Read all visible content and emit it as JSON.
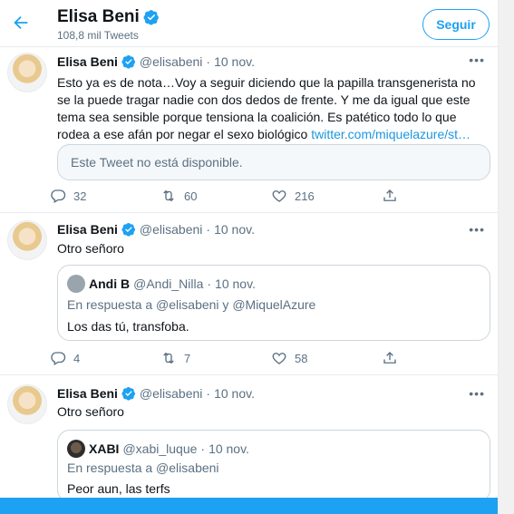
{
  "header": {
    "name": "Elisa Beni",
    "tweet_count": "108,8 mil Tweets",
    "follow_label": "Seguir"
  },
  "tweets": [
    {
      "name": "Elisa Beni",
      "handle": "@elisabeni",
      "dot": "·",
      "date": "10 nov.",
      "more": "•••",
      "text": "Esto ya es de nota…Voy a seguir diciendo que la papilla transgenerista no se la puede tragar nadie con dos dedos de frente. Y me da igual que este tema sea sensible porque tensiona la coalición. Es patético todo lo que rodea a ese afán por negar el sexo biológico ",
      "link": "twitter.com/miquelazure/st…",
      "quote_unavailable": "Este Tweet no está disponible.",
      "replies": "32",
      "retweets": "60",
      "likes": "216"
    },
    {
      "name": "Elisa Beni",
      "handle": "@elisabeni",
      "dot": "·",
      "date": "10 nov.",
      "more": "•••",
      "text": "Otro señoro",
      "quote": {
        "name": "Andi B",
        "handle": "@Andi_Nilla",
        "dot": "·",
        "date": "10 nov.",
        "reply_to": "En respuesta a @elisabeni y @MiquelAzure",
        "text": "Los das tú, transfoba."
      },
      "replies": "4",
      "retweets": "7",
      "likes": "58"
    },
    {
      "name": "Elisa Beni",
      "handle": "@elisabeni",
      "dot": "·",
      "date": "10 nov.",
      "more": "•••",
      "text": "Otro señoro",
      "quote": {
        "name": "XABI",
        "handle": "@xabi_luque",
        "dot": "·",
        "date": "10 nov.",
        "reply_to": "En respuesta a @elisabeni",
        "text": "Peor aun, las terfs"
      }
    }
  ],
  "icons": {
    "back": "arrow-left-icon",
    "verified": "verified-badge-icon",
    "reply": "reply-icon",
    "retweet": "retweet-icon",
    "like": "heart-icon",
    "share": "share-icon",
    "more": "more-icon"
  },
  "colors": {
    "accent": "#1da1f2",
    "muted": "#5b7083",
    "border": "#e6ecf0",
    "link": "#1b95e0"
  }
}
